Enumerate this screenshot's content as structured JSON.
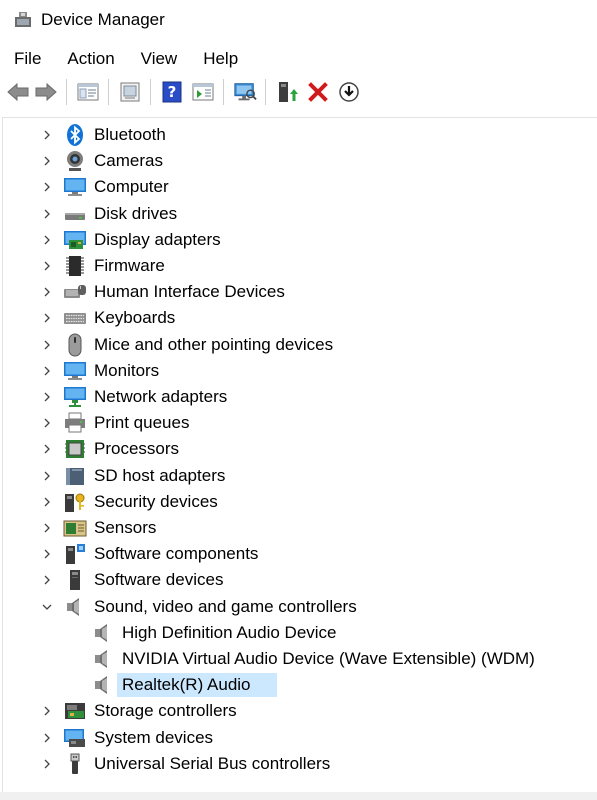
{
  "window": {
    "title": "Device Manager"
  },
  "menu": [
    "File",
    "Action",
    "View",
    "Help"
  ],
  "toolbar": [
    "back-icon",
    "forward-icon",
    "properties-icon",
    "show-hide-icon",
    "help-icon",
    "action-pane-icon",
    "scan-hardware-icon",
    "update-driver-icon",
    "uninstall-icon",
    "disable-icon"
  ],
  "categories": [
    {
      "label": "Bluetooth",
      "icon": "bluetooth-icon",
      "expanded": false
    },
    {
      "label": "Cameras",
      "icon": "camera-icon",
      "expanded": false
    },
    {
      "label": "Computer",
      "icon": "computer-icon",
      "expanded": false
    },
    {
      "label": "Disk drives",
      "icon": "disk-drive-icon",
      "expanded": false
    },
    {
      "label": "Display adapters",
      "icon": "display-adapter-icon",
      "expanded": false
    },
    {
      "label": "Firmware",
      "icon": "firmware-icon",
      "expanded": false
    },
    {
      "label": "Human Interface Devices",
      "icon": "hid-icon",
      "expanded": false
    },
    {
      "label": "Keyboards",
      "icon": "keyboard-icon",
      "expanded": false
    },
    {
      "label": "Mice and other pointing devices",
      "icon": "mouse-icon",
      "expanded": false
    },
    {
      "label": "Monitors",
      "icon": "monitor-icon",
      "expanded": false
    },
    {
      "label": "Network adapters",
      "icon": "network-adapter-icon",
      "expanded": false
    },
    {
      "label": "Print queues",
      "icon": "printer-icon",
      "expanded": false
    },
    {
      "label": "Processors",
      "icon": "processor-icon",
      "expanded": false
    },
    {
      "label": "SD host adapters",
      "icon": "sd-host-icon",
      "expanded": false
    },
    {
      "label": "Security devices",
      "icon": "security-device-icon",
      "expanded": false
    },
    {
      "label": "Sensors",
      "icon": "sensor-icon",
      "expanded": false
    },
    {
      "label": "Software components",
      "icon": "software-component-icon",
      "expanded": false
    },
    {
      "label": "Software devices",
      "icon": "software-device-icon",
      "expanded": false
    },
    {
      "label": "Sound, video and game controllers",
      "icon": "speaker-icon",
      "expanded": true,
      "children": [
        {
          "label": "High Definition Audio Device",
          "icon": "speaker-icon",
          "selected": false
        },
        {
          "label": "NVIDIA Virtual Audio Device (Wave Extensible) (WDM)",
          "icon": "speaker-icon",
          "selected": false
        },
        {
          "label": "Realtek(R) Audio",
          "icon": "speaker-icon",
          "selected": true
        }
      ]
    },
    {
      "label": "Storage controllers",
      "icon": "storage-controller-icon",
      "expanded": false
    },
    {
      "label": "System devices",
      "icon": "system-device-icon",
      "expanded": false
    },
    {
      "label": "Universal Serial Bus controllers",
      "icon": "usb-icon",
      "expanded": false
    }
  ],
  "colors": {
    "selection": "#cce8ff",
    "accent": "#1e6fd9",
    "uninstall": "#d11a1a"
  }
}
